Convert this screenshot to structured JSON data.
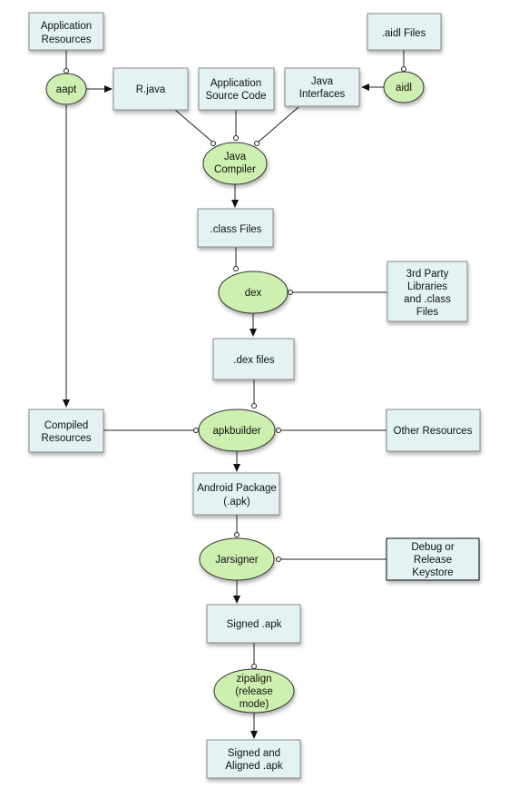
{
  "diagram": {
    "nodes": {
      "app_resources": [
        "Application",
        "Resources"
      ],
      "aidl_files": [
        ".aidl Files"
      ],
      "aapt": [
        "aapt"
      ],
      "r_java": [
        "R.java"
      ],
      "app_source": [
        "Application",
        "Source Code"
      ],
      "java_interfaces": [
        "Java",
        "Interfaces"
      ],
      "aidl": [
        "aidl"
      ],
      "java_compiler": [
        "Java",
        "Compiler"
      ],
      "class_files": [
        ".class Files"
      ],
      "dex": [
        "dex"
      ],
      "third_party": [
        "3rd Party",
        "Libraries",
        "and .class",
        "Files"
      ],
      "dex_files": [
        ".dex files"
      ],
      "compiled_resources": [
        "Compiled",
        "Resources"
      ],
      "apkbuilder": [
        "apkbuilder"
      ],
      "other_resources": [
        "Other Resources"
      ],
      "android_package": [
        "Android Package",
        "(.apk)"
      ],
      "jarsigner": [
        "Jarsigner"
      ],
      "keystore": [
        "Debug or",
        "Release",
        "Keystore"
      ],
      "signed_apk": [
        "Signed .apk"
      ],
      "zipalign": [
        "zipalign",
        "(release",
        "mode)"
      ],
      "signed_aligned": [
        "Signed and",
        "Aligned .apk"
      ]
    },
    "colors": {
      "data_box": "#e3f3f4",
      "process": "#cdefaf",
      "border": "#8a8a8a"
    }
  }
}
